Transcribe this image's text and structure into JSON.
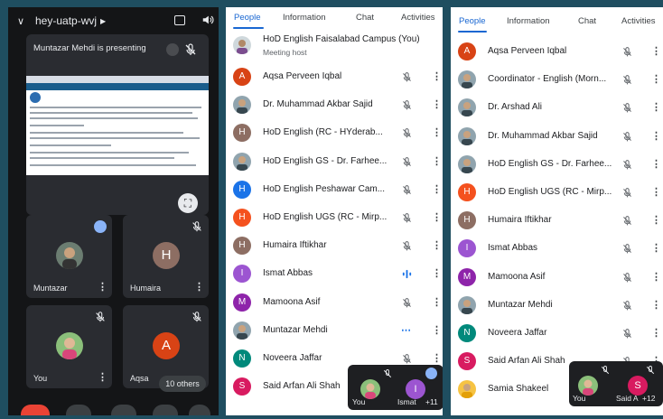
{
  "call": {
    "meeting_code": "hey-uatp-wvj",
    "presenting_text": "Muntazar Mehdi is presenting",
    "tiles": [
      {
        "name": "Muntazar",
        "avatar": "photo-man"
      },
      {
        "name": "Humaira",
        "avatar": "letter",
        "letter": "H",
        "color": "#8d6e63"
      },
      {
        "name": "You",
        "avatar": "photo-woman"
      },
      {
        "name": "Aqsa",
        "avatar": "letter",
        "letter": "A",
        "color": "#d84315"
      }
    ],
    "others_label": "10 others"
  },
  "panel_left": {
    "tabs": [
      "People",
      "Information",
      "Chat",
      "Activities"
    ],
    "active_tab": "People",
    "host_name": "HoD English Faisalabad Campus (You)",
    "host_sub": "Meeting host",
    "participants": [
      {
        "name": "Aqsa Perveen Iqbal",
        "letter": "A",
        "color": "#d84315"
      },
      {
        "name": "Dr. Muhammad Akbar Sajid",
        "photo": true
      },
      {
        "name": "HoD English (RC - HYderab...",
        "letter": "H",
        "color": "#8d6e63"
      },
      {
        "name": "HoD English GS - Dr. Farhee...",
        "photo": true
      },
      {
        "name": "HoD English Peshawar Cam...",
        "letter": "H",
        "color": "#1a73e8"
      },
      {
        "name": "HoD English UGS (RC - Mirp...",
        "letter": "H",
        "color": "#f4511e"
      },
      {
        "name": "Humaira Iftikhar",
        "letter": "H",
        "color": "#8d6e63"
      },
      {
        "name": "Ismat Abbas",
        "letter": "I",
        "color": "#9c55d1",
        "speaking": true
      },
      {
        "name": "Mamoona Asif",
        "letter": "M",
        "color": "#8e24aa"
      },
      {
        "name": "Muntazar Mehdi",
        "photo": true,
        "presenting": true
      },
      {
        "name": "Noveera Jaffar",
        "letter": "N",
        "color": "#00897b"
      },
      {
        "name": "Said Arfan Ali Shah",
        "letter": "S",
        "color": "#d81b60"
      }
    ],
    "mini": {
      "you_label": "You",
      "other_label": "Ismat",
      "other_letter": "I",
      "count": "+11"
    }
  },
  "panel_right": {
    "tabs": [
      "People",
      "Information",
      "Chat",
      "Activities"
    ],
    "active_tab": "People",
    "participants": [
      {
        "name": "Aqsa Perveen Iqbal",
        "letter": "A",
        "color": "#d84315"
      },
      {
        "name": "Coordinator - English (Morn...",
        "photo": true
      },
      {
        "name": "Dr. Arshad Ali",
        "photo": true
      },
      {
        "name": "Dr. Muhammad Akbar Sajid",
        "photo": true
      },
      {
        "name": "HoD English GS - Dr. Farhee...",
        "photo": true
      },
      {
        "name": "HoD English UGS (RC - Mirp...",
        "letter": "H",
        "color": "#f4511e"
      },
      {
        "name": "Humaira Iftikhar",
        "letter": "H",
        "color": "#8d6e63"
      },
      {
        "name": "Ismat Abbas",
        "letter": "I",
        "color": "#9c55d1"
      },
      {
        "name": "Mamoona Asif",
        "letter": "M",
        "color": "#8e24aa"
      },
      {
        "name": "Muntazar Mehdi",
        "photo": true
      },
      {
        "name": "Noveera Jaffar",
        "letter": "N",
        "color": "#00897b"
      },
      {
        "name": "Said Arfan Ali Shah",
        "letter": "S",
        "color": "#d81b60"
      },
      {
        "name": "Samia Shakeel",
        "photo": true,
        "flower": true
      }
    ],
    "mini": {
      "you_label": "You",
      "other_label": "Said A",
      "other_letter": "S",
      "count": "+12"
    }
  },
  "icons": {
    "mute": "mic-off-icon",
    "more": "more-vert-icon",
    "speaking": "audio-level-icon"
  }
}
